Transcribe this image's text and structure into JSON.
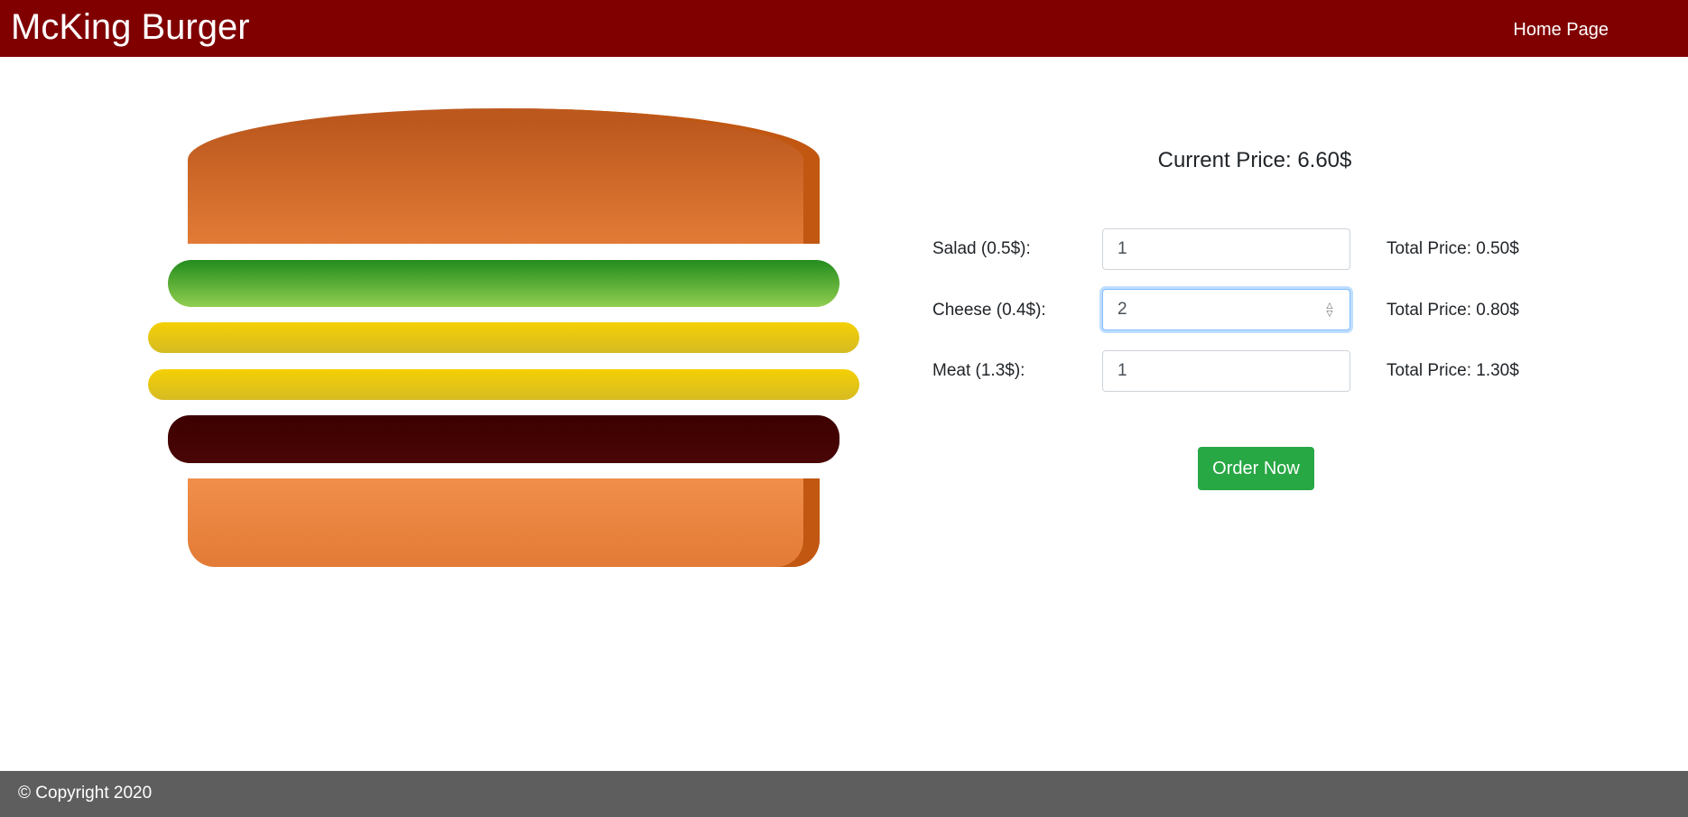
{
  "header": {
    "brand": "McKing Burger",
    "home_link": "Home Page",
    "background_color": "#800000"
  },
  "burger": {
    "layers": [
      "bread-top",
      "salad",
      "cheese",
      "cheese",
      "meat",
      "bread-bottom"
    ]
  },
  "order": {
    "current_price_text": "Current Price: 6.60$",
    "rows": [
      {
        "label": "Salad (0.5$):",
        "quantity": "1",
        "total": "Total Price: 0.50$"
      },
      {
        "label": "Cheese (0.4$):",
        "quantity": "2",
        "total": "Total Price: 0.80$"
      },
      {
        "label": "Meat (1.3$):",
        "quantity": "1",
        "total": "Total Price: 1.30$"
      }
    ],
    "order_button": "Order Now",
    "button_color": "#28a745"
  },
  "footer": {
    "copyright": "© Copyright 2020",
    "background_color": "#5e5e5e"
  }
}
